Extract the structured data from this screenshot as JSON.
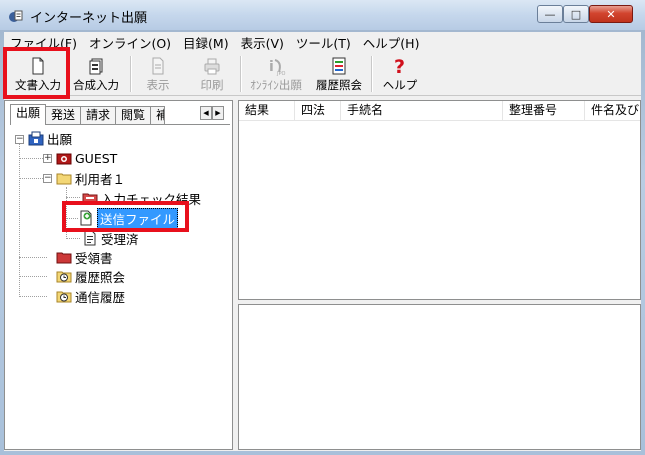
{
  "window": {
    "title": "インターネット出願"
  },
  "window_controls": {
    "minimize": "—",
    "maximize": "□",
    "close": "✕"
  },
  "menu": [
    {
      "label": "ファイル(F)"
    },
    {
      "label": "オンライン(O)"
    },
    {
      "label": "目録(M)"
    },
    {
      "label": "表示(V)"
    },
    {
      "label": "ツール(T)"
    },
    {
      "label": "ヘルプ(H)"
    }
  ],
  "toolbar": {
    "doc_input": "文書入力",
    "compose_input": "合成入力",
    "display": "表示",
    "print": "印刷",
    "online_filing": "ｵﾝﾗｲﾝ出願",
    "history_query": "履歴照会",
    "help": "ヘルプ"
  },
  "left_tabs": {
    "tabs": [
      {
        "label": "出願",
        "active": true
      },
      {
        "label": "発送"
      },
      {
        "label": "請求"
      },
      {
        "label": "閲覧"
      },
      {
        "label": "補"
      }
    ],
    "scroll_left": "◀",
    "scroll_right": "▶"
  },
  "tree": {
    "root": "出願",
    "guest": "GUEST",
    "user1": "利用者１",
    "input_check_result": "入力チェック結果",
    "send_file": "送信ファイル",
    "received": "受理済",
    "receipt": "受領書",
    "history_query": "履歴照会",
    "comm_history": "通信履歴",
    "collapse_glyph": "−",
    "expand_glyph": "+"
  },
  "list": {
    "columns": [
      {
        "label": "結果"
      },
      {
        "label": "四法"
      },
      {
        "label": "手続名"
      },
      {
        "label": "整理番号"
      },
      {
        "label": "件名及び"
      }
    ]
  },
  "colors": {
    "highlight_box": "#e8101c",
    "selection": "#3399ff",
    "close_button": "#c0321c"
  }
}
